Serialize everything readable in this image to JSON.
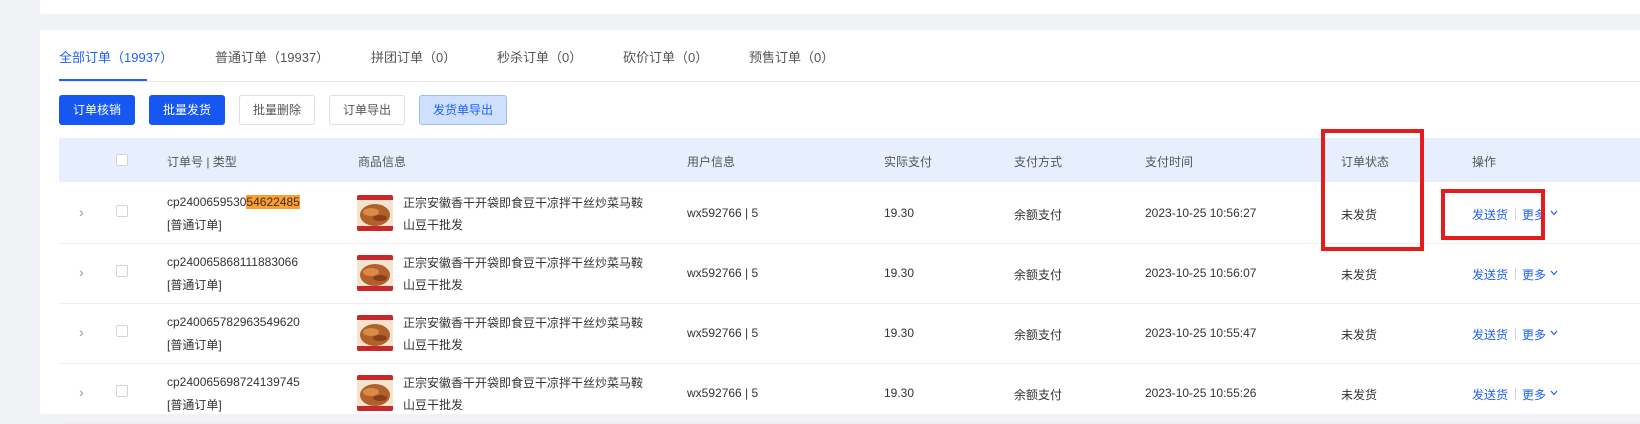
{
  "tabs": [
    {
      "label": "全部订单（19937）",
      "active": true
    },
    {
      "label": "普通订单（19937）",
      "active": false
    },
    {
      "label": "拼团订单（0）",
      "active": false
    },
    {
      "label": "秒杀订单（0）",
      "active": false
    },
    {
      "label": "砍价订单（0）",
      "active": false
    },
    {
      "label": "预售订单（0）",
      "active": false
    }
  ],
  "toolbar": {
    "verify_label": "订单核销",
    "batch_ship_label": "批量发货",
    "batch_delete_label": "批量删除",
    "export_orders_label": "订单导出",
    "export_shipping_label": "发货单导出"
  },
  "table": {
    "headers": {
      "order": "订单号 | 类型",
      "goods": "商品信息",
      "user": "用户信息",
      "paid": "实际支付",
      "pay_method": "支付方式",
      "pay_time": "支付时间",
      "status": "订单状态",
      "action": "操作"
    },
    "rows": [
      {
        "order_no_prefix": "cp2400659530",
        "order_no_highlight": "54622485",
        "type": "[普通订单]",
        "goods_line1": "正宗安徽香干开袋即食豆干凉拌干丝炒菜马鞍",
        "goods_line2": "山豆干批发",
        "user": "wx592766 | 5",
        "paid": "19.30",
        "pay_method": "余额支付",
        "pay_time": "2023-10-25 10:56:27",
        "status": "未发货",
        "ship_label": "发送货",
        "more_label": "更多"
      },
      {
        "order_no_prefix": "cp240065868111883066",
        "order_no_highlight": "",
        "type": "[普通订单]",
        "goods_line1": "正宗安徽香干开袋即食豆干凉拌干丝炒菜马鞍",
        "goods_line2": "山豆干批发",
        "user": "wx592766 | 5",
        "paid": "19.30",
        "pay_method": "余额支付",
        "pay_time": "2023-10-25 10:56:07",
        "status": "未发货",
        "ship_label": "发送货",
        "more_label": "更多"
      },
      {
        "order_no_prefix": "cp240065782963549620",
        "order_no_highlight": "",
        "type": "[普通订单]",
        "goods_line1": "正宗安徽香干开袋即食豆干凉拌干丝炒菜马鞍",
        "goods_line2": "山豆干批发",
        "user": "wx592766 | 5",
        "paid": "19.30",
        "pay_method": "余额支付",
        "pay_time": "2023-10-25 10:55:47",
        "status": "未发货",
        "ship_label": "发送货",
        "more_label": "更多"
      },
      {
        "order_no_prefix": "cp240065698724139745",
        "order_no_highlight": "",
        "type": "[普通订单]",
        "goods_line1": "正宗安徽香干开袋即食豆干凉拌干丝炒菜马鞍",
        "goods_line2": "山豆干批发",
        "user": "wx592766 | 5",
        "paid": "19.30",
        "pay_method": "余额支付",
        "pay_time": "2023-10-25 10:55:26",
        "status": "未发货",
        "ship_label": "发送货",
        "more_label": "更多"
      }
    ]
  },
  "colors": {
    "primary": "#1557f0",
    "link": "#1f5eff",
    "highlight": "#ff9e2c",
    "annotation_red": "#e51c1c",
    "header_bg": "#e7efff"
  },
  "icons": {
    "expand": "chevron-right-icon",
    "more_dropdown": "chevron-down-icon",
    "goods_thumb": "product-thumbnail"
  }
}
